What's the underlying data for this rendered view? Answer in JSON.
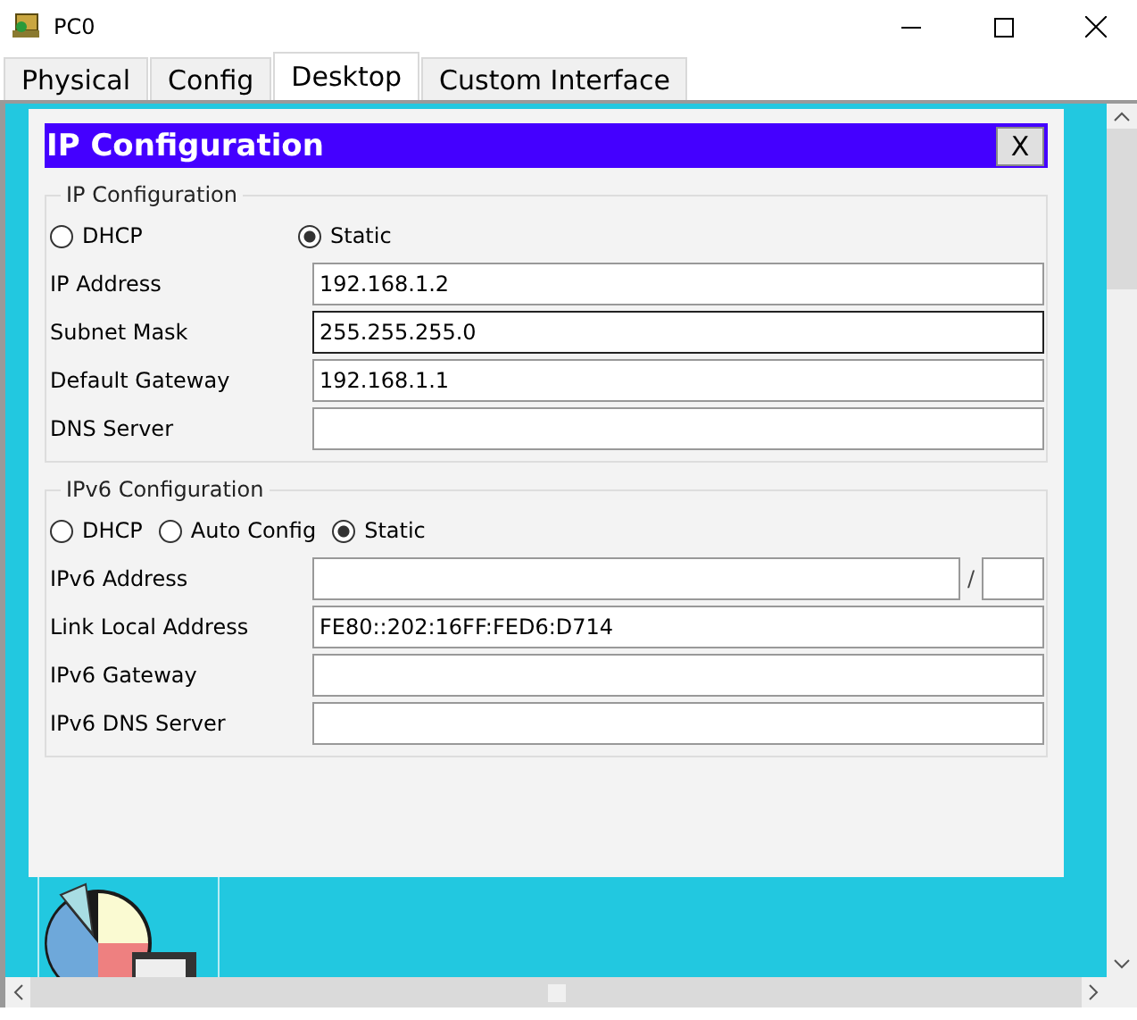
{
  "window": {
    "title": "PC0"
  },
  "tabs": [
    {
      "label": "Physical",
      "selected": false
    },
    {
      "label": "Config",
      "selected": false
    },
    {
      "label": "Desktop",
      "selected": true
    },
    {
      "label": "Custom Interface",
      "selected": false
    }
  ],
  "dialog": {
    "title": "IP Configuration",
    "close_label": "X",
    "ipv4": {
      "legend": "IP Configuration",
      "spread": true,
      "modes": [
        {
          "label": "DHCP",
          "selected": false
        },
        {
          "label": "Static",
          "selected": true
        }
      ],
      "fields": [
        {
          "kind": "text",
          "label": "IP Address",
          "value": "192.168.1.2",
          "focused": false
        },
        {
          "kind": "text",
          "label": "Subnet Mask",
          "value": "255.255.255.0",
          "focused": true
        },
        {
          "kind": "text",
          "label": "Default Gateway",
          "value": "192.168.1.1",
          "focused": false
        },
        {
          "kind": "text",
          "label": "DNS Server",
          "focused": false
        }
      ]
    },
    "ipv6": {
      "legend": "IPv6 Configuration",
      "spread": false,
      "modes": [
        {
          "label": "DHCP",
          "selected": false
        },
        {
          "label": "Auto Config",
          "selected": false
        },
        {
          "label": "Static",
          "selected": true
        }
      ],
      "fields": [
        {
          "kind": "prefixed",
          "label": "IPv6 Address",
          "separator": "/",
          "focused": false
        },
        {
          "kind": "text",
          "label": "Link Local Address",
          "value": "FE80::202:16FF:FED6:D714",
          "focused": false
        },
        {
          "kind": "text",
          "label": "IPv6 Gateway",
          "focused": false
        },
        {
          "kind": "text",
          "label": "IPv6 DNS Server",
          "focused": false
        }
      ]
    }
  }
}
